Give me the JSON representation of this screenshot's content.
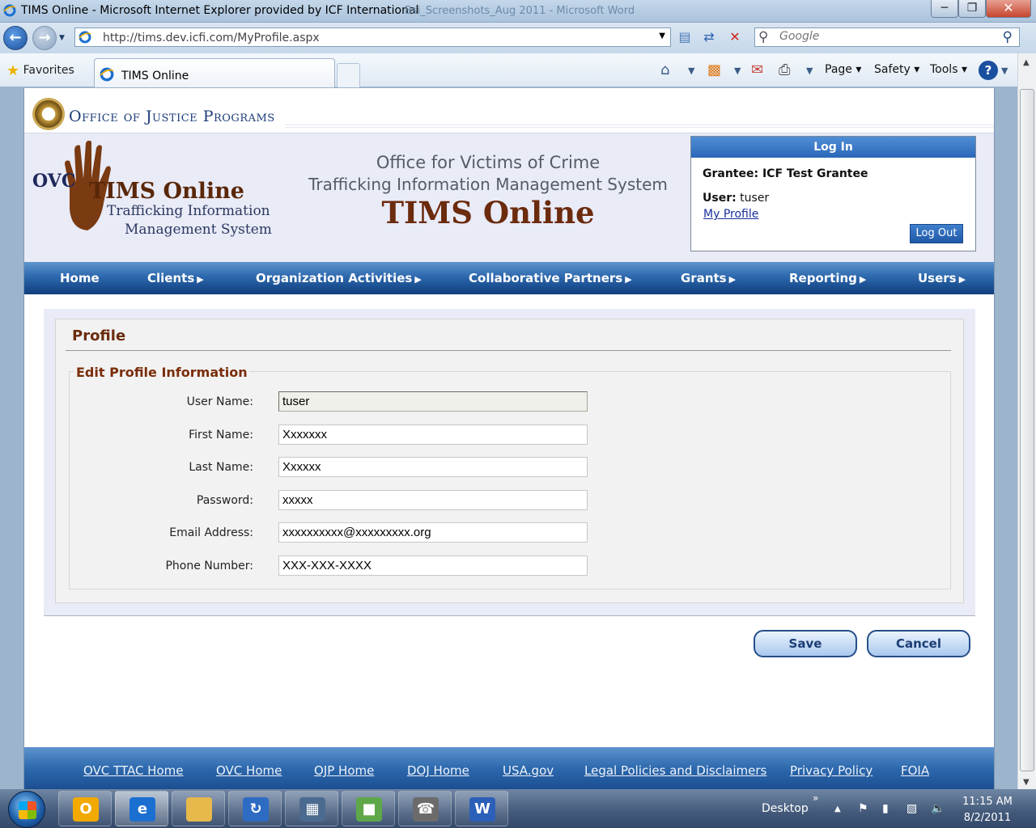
{
  "window": {
    "title": "TIMS Online - Microsoft Internet Explorer provided by ICF International",
    "ghost_text": "Bsi_Screenshots_Aug 2011 - Microsoft Word",
    "minimize": "─",
    "maximize": "❐",
    "close": "✕"
  },
  "browser": {
    "url": "http://tims.dev.icfi.com/MyProfile.aspx",
    "search_placeholder": "Google",
    "favorites_label": "Favorites",
    "tab_label": "TIMS Online",
    "commands": {
      "page": "Page ▾",
      "safety": "Safety ▾",
      "tools": "Tools ▾",
      "help": "?"
    }
  },
  "site": {
    "agency": "Office of Justice Programs",
    "logo": {
      "ovc": "OVC",
      "tims": "TIMS Online",
      "sub1": "Trafficking Information",
      "sub2": "Management System"
    },
    "heading_line1": "Office for Victims of Crime",
    "heading_line2": "Trafficking Information Management System",
    "heading_line3": "TIMS Online"
  },
  "login": {
    "header": "Log In",
    "grantee": "Grantee: ICF Test Grantee",
    "user_label": "User:",
    "user_value": "tuser",
    "my_profile": "My Profile",
    "logout": "Log Out"
  },
  "menu": {
    "home": "Home",
    "clients": "Clients",
    "org_activities": "Organization Activities",
    "partners": "Collaborative Partners",
    "grants": "Grants",
    "reporting": "Reporting",
    "users": "Users",
    "arrow": "▶"
  },
  "profile": {
    "title": "Profile",
    "section": "Edit Profile Information",
    "fields": {
      "username_label": "User Name:",
      "username_value": "tuser",
      "firstname_label": "First Name:",
      "firstname_value": "Xxxxxxx",
      "lastname_label": "Last Name:",
      "lastname_value": "Xxxxxx",
      "password_label": "Password:",
      "password_value": "xxxxx",
      "email_label": "Email Address:",
      "email_value": "xxxxxxxxxx@xxxxxxxxx.org",
      "phone_label": "Phone Number:",
      "phone_value": "XXX-XXX-XXXX"
    },
    "save": "Save",
    "cancel": "Cancel"
  },
  "footer": {
    "ovc_ttac": "OVC TTAC Home",
    "ovc": "OVC Home",
    "ojp": "OJP Home",
    "doj": "DOJ Home",
    "usa": "USA.gov",
    "legal": "Legal Policies and Disclaimers",
    "privacy": "Privacy Policy",
    "foia": "FOIA"
  },
  "taskbar": {
    "desktop": "Desktop",
    "time": "11:15 AM",
    "date": "8/2/2011"
  }
}
